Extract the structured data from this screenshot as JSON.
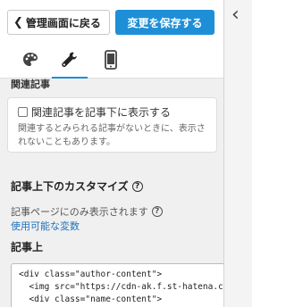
{
  "header": {
    "back_label": "管理画面に戻る",
    "save_label": "変更を保存する"
  },
  "tabs": [
    {
      "icon": "palette-icon"
    },
    {
      "icon": "wrench-icon",
      "active": true
    },
    {
      "icon": "smartphone-icon"
    }
  ],
  "section_cut_title": "関連記事",
  "related": {
    "checkbox_label": "関連記事を記事下に表示する",
    "checked": false,
    "description": "関連するとみられる記事がないときに、表示されないこともあります。"
  },
  "customize": {
    "title": "記事上下のカスタマイズ",
    "note": "記事ページにのみ表示されます",
    "vars_link": "使用可能な変数",
    "above_label": "記事上",
    "code_lines": [
      "<div class=\"author-content\">",
      "  <img src=\"https://cdn-ak.f.st-hatena.com/im",
      "  <div class=\"name-content\">"
    ]
  },
  "colors": {
    "accent": "#1e8fd6",
    "link": "#1e73be"
  }
}
